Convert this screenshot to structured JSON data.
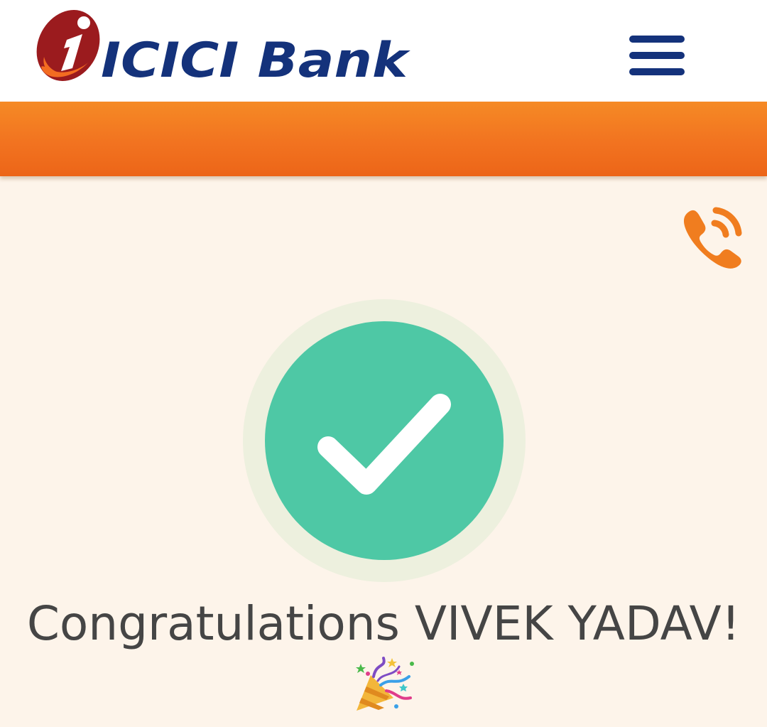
{
  "header": {
    "logo": {
      "icon_name": "icici-i-logo-icon",
      "brand_text": "ICICI Bank",
      "brand_color": "#14327b",
      "logo_red": "#9b1b1e",
      "logo_orange": "#f36c21"
    },
    "menu_icon": "hamburger-menu-icon"
  },
  "band": {
    "color_top": "#f58a25",
    "color_bottom": "#ec6518"
  },
  "support": {
    "call_icon": "phone-call-icon",
    "color": "#f07d1f"
  },
  "success": {
    "icon_name": "checkmark-icon",
    "circle_color": "#4ec8a5",
    "halo_color": "#edf0de",
    "message": "Congratulations VIVEK YADAV!",
    "emoji": "🎉"
  },
  "theme": {
    "background": "#fdf4ea",
    "text_color": "#454545"
  }
}
